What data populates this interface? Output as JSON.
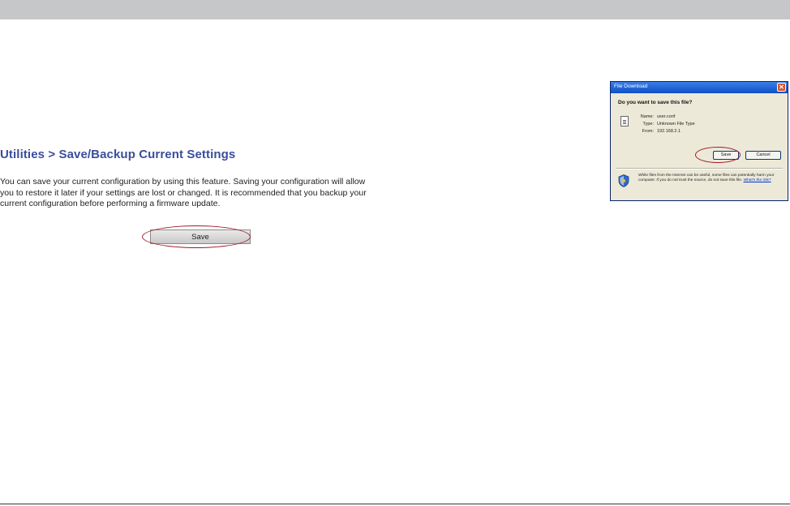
{
  "router_page": {
    "title": "Utilities > Save/Backup Current Settings",
    "description": "You can save your current configuration by using this feature. Saving your configuration will allow you to restore it later if your settings are lost or changed. It is recommended that you backup your current configuration before performing a firmware update.",
    "save_label": "Save"
  },
  "dialog": {
    "title": "File Download",
    "close_glyph": "✕",
    "question": "Do you want to save this file?",
    "file": {
      "name_label": "Name:",
      "name_value": "user.conf",
      "type_label": "Type:",
      "type_value": "Unknown File Type",
      "from_label": "From:",
      "from_value": "192.168.2.1"
    },
    "save_label": "Save",
    "cancel_label": "Cancel",
    "warning_text": "While files from the Internet can be useful, some files can potentially harm your computer. If you do not trust the source, do not save this file.",
    "warning_link": "What's the risk?"
  },
  "colors": {
    "top_bar": "#c6c7c9",
    "title_blue": "#3a4e9c",
    "highlight_red": "#a3192a",
    "xp_title_blue": "#0f4fc6",
    "dialog_bg": "#ece9d8"
  },
  "icons": {
    "file": "file-icon",
    "shield": "shield-icon",
    "close": "close-icon"
  }
}
